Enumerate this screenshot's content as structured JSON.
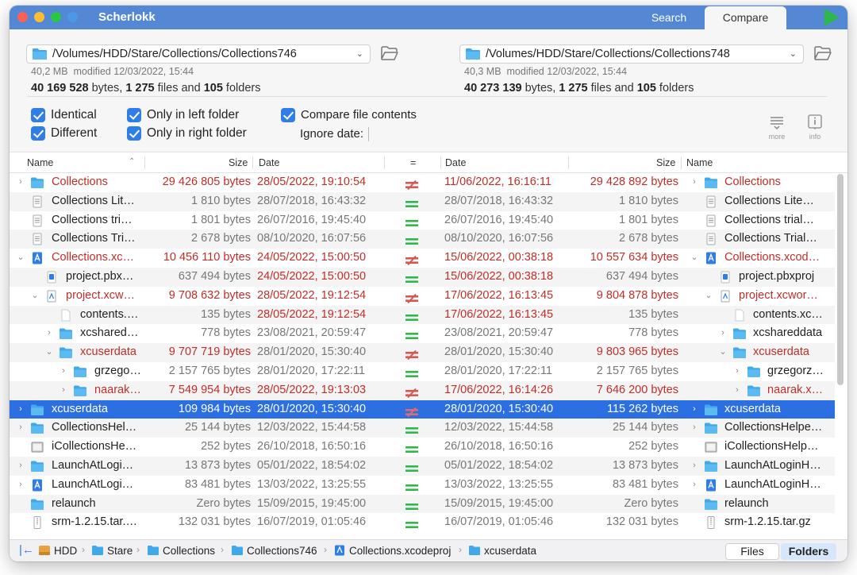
{
  "app": {
    "title": "Scherlokk",
    "tabs": {
      "search": "Search",
      "compare": "Compare"
    },
    "active_tab": "Compare"
  },
  "left": {
    "path": "/Volumes/HDD/Stare/Collections/Collections746",
    "size": "40,2 MB",
    "modified": "modified 12/03/2022, 15:44",
    "bytes": "40 169 528",
    "bytes_suffix": " bytes, ",
    "files": "1 275",
    "files_suffix": " files and ",
    "folders": "105",
    "folders_suffix": " folders"
  },
  "right": {
    "path": "/Volumes/HDD/Stare/Collections/Collections748",
    "size": "40,3 MB",
    "modified": "modified 12/03/2022, 15:44",
    "bytes": "40 273 139",
    "bytes_suffix": " bytes, ",
    "files": "1 275",
    "files_suffix": " files and ",
    "folders": "105",
    "folders_suffix": " folders"
  },
  "filters": {
    "identical": "Identical",
    "different": "Different",
    "only_left": "Only in left folder",
    "only_right": "Only in right folder",
    "compare_contents": "Compare file contents",
    "ignore_date": "Ignore date:"
  },
  "toolbar": {
    "more": "more",
    "info": "info"
  },
  "columns": {
    "name": "Name",
    "size": "Size",
    "date": "Date",
    "eq": "=",
    "date_r": "Date",
    "size_r": "Size",
    "name_r": "Name"
  },
  "rows": [
    {
      "d": 0,
      "tw": "›",
      "icon": "folder",
      "ln": "Collections",
      "ls": "29 426 805 bytes",
      "ld": "28/05/2022, 19:10:54",
      "eq": "diff",
      "rd": "11/06/2022, 16:16:11",
      "rs": "29 428 892 bytes",
      "rn": "Collections",
      "red": true
    },
    {
      "d": 0,
      "tw": "",
      "icon": "doc",
      "ln": "Collections Lit…",
      "ls": "1 810 bytes",
      "ld": "28/07/2018, 16:43:32",
      "eq": "same",
      "rd": "28/07/2018, 16:43:32",
      "rs": "1 810 bytes",
      "rn": "Collections Lite…",
      "red": false
    },
    {
      "d": 0,
      "tw": "",
      "icon": "doc",
      "ln": "Collections tri…",
      "ls": "1 801 bytes",
      "ld": "26/07/2016, 19:45:40",
      "eq": "same",
      "rd": "26/07/2016, 19:45:40",
      "rs": "1 801 bytes",
      "rn": "Collections trial…",
      "red": false
    },
    {
      "d": 0,
      "tw": "",
      "icon": "doc",
      "ln": "Collections Tri…",
      "ls": "2 678 bytes",
      "ld": "08/10/2020, 16:07:56",
      "eq": "same",
      "rd": "08/10/2020, 16:07:56",
      "rs": "2 678 bytes",
      "rn": "Collections Trial…",
      "red": false
    },
    {
      "d": 0,
      "tw": "⌄",
      "icon": "xcode",
      "ln": "Collections.xc…",
      "ls": "10 456 110 bytes",
      "ld": "24/05/2022, 15:00:50",
      "eq": "diff",
      "rd": "15/06/2022, 00:38:18",
      "rs": "10 557 634 bytes",
      "rn": "Collections.xcod…",
      "red": true
    },
    {
      "d": 1,
      "tw": "",
      "icon": "pbx",
      "ln": "project.pbx…",
      "ls": "637 494 bytes",
      "ld": "24/05/2022, 15:00:50",
      "eq": "same",
      "rd": "15/06/2022, 00:38:18",
      "rs": "637 494 bytes",
      "rn": "project.pbxproj",
      "red": false,
      "datesred": true
    },
    {
      "d": 1,
      "tw": "⌄",
      "icon": "ws",
      "ln": "project.xcw…",
      "ls": "9 708 632 bytes",
      "ld": "28/05/2022, 19:12:54",
      "eq": "diff",
      "rd": "17/06/2022, 16:13:45",
      "rs": "9 804 878 bytes",
      "rn": "project.xcwor…",
      "red": true
    },
    {
      "d": 2,
      "tw": "",
      "icon": "blank",
      "ln": "contents.…",
      "ls": "135 bytes",
      "ld": "28/05/2022, 19:12:54",
      "eq": "same",
      "rd": "17/06/2022, 16:13:45",
      "rs": "135 bytes",
      "rn": "contents.xc…",
      "red": false,
      "datesred": true
    },
    {
      "d": 2,
      "tw": "›",
      "icon": "folder",
      "ln": "xcshared…",
      "ls": "778 bytes",
      "ld": "23/08/2021, 20:59:47",
      "eq": "same",
      "rd": "23/08/2021, 20:59:47",
      "rs": "778 bytes",
      "rn": "xcshareddata",
      "red": false
    },
    {
      "d": 2,
      "tw": "⌄",
      "icon": "folder",
      "ln": "xcuserdata",
      "ls": "9 707 719 bytes",
      "ld": "28/01/2020, 15:30:40",
      "eq": "diff",
      "rd": "28/01/2020, 15:30:40",
      "rs": "9 803 965 bytes",
      "rn": "xcuserdata",
      "red": true,
      "datesgray": true
    },
    {
      "d": 3,
      "tw": "›",
      "icon": "folder",
      "ln": "grzego…",
      "ls": "2 157 765 bytes",
      "ld": "28/01/2020, 17:22:11",
      "eq": "same",
      "rd": "28/01/2020, 17:22:11",
      "rs": "2 157 765 bytes",
      "rn": "grzegorz…",
      "red": false
    },
    {
      "d": 3,
      "tw": "›",
      "icon": "folder",
      "ln": "naarak…",
      "ls": "7 549 954 bytes",
      "ld": "28/05/2022, 19:13:03",
      "eq": "diff",
      "rd": "17/06/2022, 16:14:26",
      "rs": "7 646 200 bytes",
      "rn": "naarak.x…",
      "red": true
    },
    {
      "d": 0,
      "tw": "›",
      "icon": "folder",
      "ln": "xcuserdata",
      "ls": "109 984 bytes",
      "ld": "28/01/2020, 15:30:40",
      "eq": "diff",
      "rd": "28/01/2020, 15:30:40",
      "rs": "115 262 bytes",
      "rn": "xcuserdata",
      "red": true,
      "sel": true
    },
    {
      "d": 0,
      "tw": "›",
      "icon": "folder",
      "ln": "CollectionsHel…",
      "ls": "25 144 bytes",
      "ld": "12/03/2022, 15:44:58",
      "eq": "same",
      "rd": "12/03/2022, 15:44:58",
      "rs": "25 144 bytes",
      "rn": "CollectionsHelpe…",
      "red": false
    },
    {
      "d": 0,
      "tw": "",
      "icon": "img",
      "ln": "iCollectionsHe…",
      "ls": "252 bytes",
      "ld": "26/10/2018, 16:50:16",
      "eq": "same",
      "rd": "26/10/2018, 16:50:16",
      "rs": "252 bytes",
      "rn": "iCollectionsHelp…",
      "red": false
    },
    {
      "d": 0,
      "tw": "›",
      "icon": "folder",
      "ln": "LaunchAtLogi…",
      "ls": "13 873 bytes",
      "ld": "05/01/2022, 18:54:02",
      "eq": "same",
      "rd": "05/01/2022, 18:54:02",
      "rs": "13 873 bytes",
      "rn": "LaunchAtLoginH…",
      "red": false
    },
    {
      "d": 0,
      "tw": "›",
      "icon": "xcode",
      "ln": "LaunchAtLogi…",
      "ls": "83 481 bytes",
      "ld": "13/03/2022, 13:25:55",
      "eq": "same",
      "rd": "13/03/2022, 13:25:55",
      "rs": "83 481 bytes",
      "rn": "LaunchAtLoginH…",
      "red": false
    },
    {
      "d": 0,
      "tw": "",
      "icon": "folder",
      "ln": "relaunch",
      "ls": "Zero bytes",
      "ld": "15/09/2015, 19:45:00",
      "eq": "same",
      "rd": "15/09/2015, 19:45:00",
      "rs": "Zero bytes",
      "rn": "relaunch",
      "red": false
    },
    {
      "d": 0,
      "tw": "",
      "icon": "gz",
      "ln": "srm-1.2.15.tar.…",
      "ls": "132 031 bytes",
      "ld": "16/07/2019, 01:05:46",
      "eq": "same",
      "rd": "16/07/2019, 01:05:46",
      "rs": "132 031 bytes",
      "rn": "srm-1.2.15.tar.gz",
      "red": false
    }
  ],
  "breadcrumb": [
    "HDD",
    "Stare",
    "Collections",
    "Collections746",
    "Collections.xcodeproj",
    "xcuserdata"
  ],
  "view_modes": {
    "files": "Files",
    "folders": "Folders",
    "active": "Folders"
  },
  "colors": {
    "titlebar": "#5488d4",
    "accent": "#2b6fe2",
    "diff_red": "#c22d27",
    "same_green": "#2db84a",
    "folder_blue": "#3fa9ea"
  }
}
